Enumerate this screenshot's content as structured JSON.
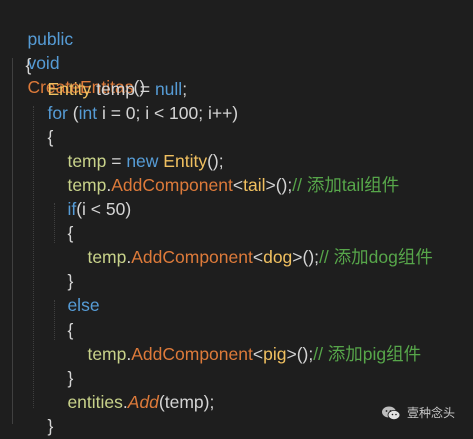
{
  "code": {
    "signature": {
      "kw_public": "public",
      "kw_void": "void",
      "method_name": "CreateEntitas",
      "parens": "()"
    },
    "open_brace_method": "{",
    "declaration": {
      "type": "Entity",
      "rest": " temp = ",
      "kw_null": "null",
      "semi": ";"
    },
    "for_stmt": {
      "kw_for": "for",
      "open": " (",
      "kw_int": "int",
      "rest": " i = 0; i < 100; i++)"
    },
    "open_brace_for": "{",
    "assign_line": {
      "var": "temp",
      "eq": " = ",
      "kw_new": "new",
      "sp": " ",
      "type": "Entity",
      "tail": "();"
    },
    "add_tail": {
      "var": "temp",
      "dot": ".",
      "method": "AddComponent",
      "lt": "<",
      "generic": "tail",
      "gt": ">",
      "call": "();",
      "comment": "// 添加tail组件"
    },
    "if_stmt": {
      "kw_if": "if",
      "rest": "(i < 50)"
    },
    "open_brace_if": "{",
    "add_dog": {
      "var": "temp",
      "dot": ".",
      "method": "AddComponent",
      "lt": "<",
      "generic": "dog",
      "gt": ">",
      "call": "();",
      "comment": "// 添加dog组件"
    },
    "close_brace_if": "}",
    "else_kw": "else",
    "open_brace_else": "{",
    "add_pig": {
      "var": "temp",
      "dot": ".",
      "method": "AddComponent",
      "lt": "<",
      "generic": "pig",
      "gt": ">",
      "call": "();",
      "comment": "// 添加pig组件"
    },
    "close_brace_else": "}",
    "entities_add": {
      "var": "entities",
      "dot": ".",
      "method": "Add",
      "args": "(temp);"
    },
    "close_brace_for": "}",
    "close_brace_method": "}"
  },
  "watermark": {
    "text": "壹种念头",
    "icon": "wechat-icon"
  },
  "colors": {
    "background": "#1e1e1e",
    "keyword": "#569cd6",
    "method": "#dd7a3a",
    "type": "#f0c060",
    "comment": "#57a64a",
    "plain": "#d4d4d4"
  }
}
